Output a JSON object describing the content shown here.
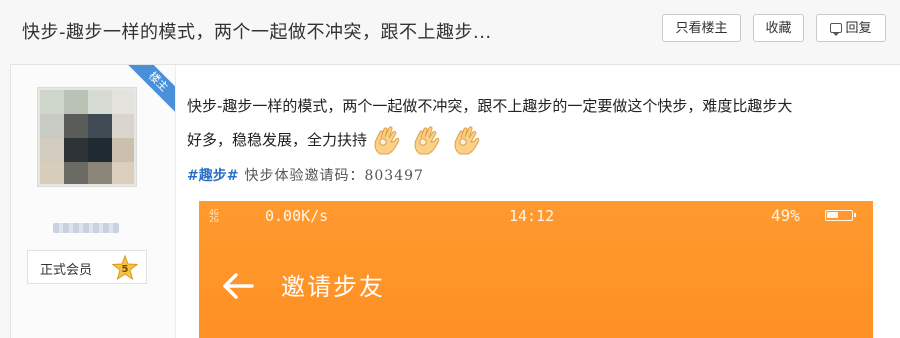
{
  "header": {
    "thread_title": "快步-趣步一样的模式，两个一起做不冲突，跟不上趣步...",
    "only_op_label": "只看楼主",
    "favorite_label": "收藏",
    "reply_label": "回复"
  },
  "author": {
    "op_badge": "楼主",
    "member_group": "正式会员",
    "level": "5"
  },
  "post": {
    "body_line1": "快步-趣步一样的模式，两个一起做不冲突，跟不上趣步的一定要做这个快步，难度比趣步大",
    "body_line2": "好多，稳稳发展，全力扶持",
    "emoji_icon": "ok-hand-emoji",
    "tag": "#趣步#",
    "invite_text": "快步体验邀请码：803497"
  },
  "embedded_screenshot": {
    "background_color": "#ff9a2e",
    "signal_top": "4G",
    "signal_bottom": "2G",
    "net_speed": "0.00K/s",
    "clock": "14:12",
    "battery_percent": "49%",
    "page_title": "邀请步友",
    "back_icon": "arrow-left-icon"
  }
}
